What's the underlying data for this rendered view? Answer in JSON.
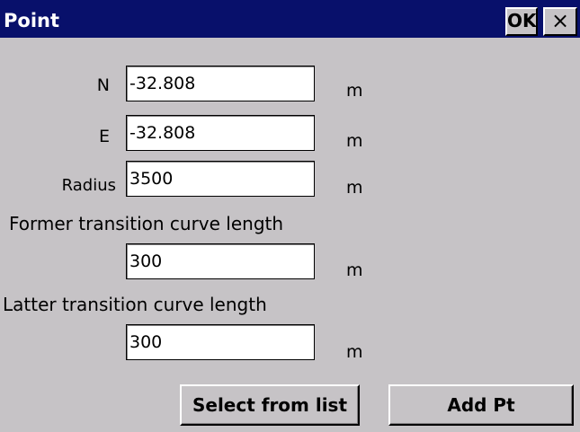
{
  "window": {
    "title": "Point",
    "ok_label": "OK",
    "close_label": "×"
  },
  "fields": [
    {
      "label": "N",
      "value": "-32.808",
      "unit": "m"
    },
    {
      "label": "E",
      "value": "-32.808",
      "unit": "m"
    },
    {
      "label": "Radius",
      "value": "3500",
      "unit": "m"
    },
    {
      "label": "Former transition curve length",
      "value": "300",
      "unit": "m"
    },
    {
      "label": "Latter transition curve length",
      "value": "300",
      "unit": "m"
    }
  ],
  "buttons": {
    "select_from_list": "Select from list",
    "add_pt": "Add Pt"
  }
}
